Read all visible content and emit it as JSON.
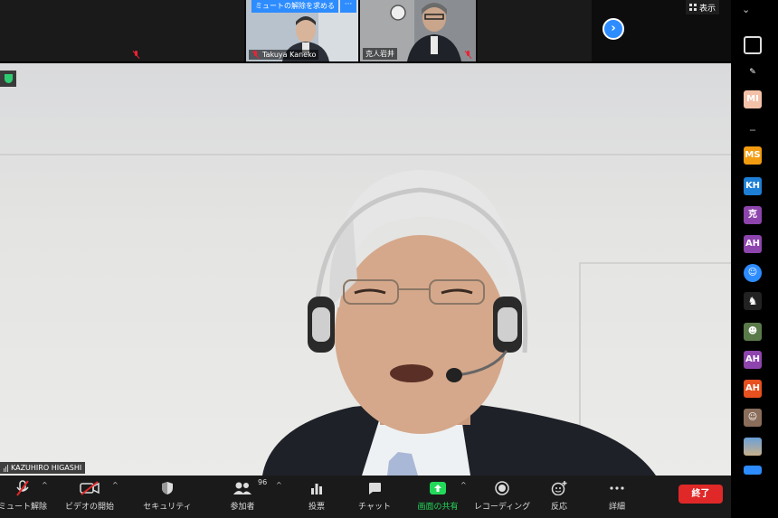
{
  "top_strip": {
    "unmute_request_label": "ミュートの解除を求める",
    "more_label": "···",
    "thumbnails": [
      {
        "name": "Takuya Kaneko"
      },
      {
        "name": "克人岩井"
      }
    ],
    "next_page_icon": "chevron-right-icon",
    "view_label": "表示"
  },
  "main_video": {
    "speaker_name": "KAZUHIRO HIGASHI"
  },
  "sidebar": {
    "collapse_icon": "chevron-down-icon",
    "tiles": [
      {
        "label": "",
        "bg": "#000000"
      },
      {
        "label": "",
        "bg": "#000000"
      },
      {
        "label": "MI",
        "bg": "#f3c1a8"
      },
      {
        "label": "",
        "bg": "#000000"
      },
      {
        "label": "MS",
        "bg": "#f39c12"
      },
      {
        "label": "KH",
        "bg": "#1e7fd6"
      },
      {
        "label": "克",
        "bg": "#8e44ad"
      },
      {
        "label": "AH",
        "bg": "#8e44ad"
      },
      {
        "label": "",
        "bg": "#2d8cff"
      },
      {
        "label": "",
        "bg": "#222222"
      },
      {
        "label": "",
        "bg": "#5a7a4a"
      },
      {
        "label": "AH",
        "bg": "#8e44ad"
      },
      {
        "label": "AH",
        "bg": "#e8501f"
      },
      {
        "label": "",
        "bg": "#8a6d5a"
      },
      {
        "label": "",
        "bg": "#4a7fb8"
      },
      {
        "label": "",
        "bg": "#2d8cff"
      }
    ]
  },
  "toolbar": {
    "items": [
      {
        "label": "ミュート解除",
        "icon": "mic-off-icon"
      },
      {
        "label": "ビデオの開始",
        "icon": "video-off-icon"
      },
      {
        "label": "セキュリティ",
        "icon": "shield-icon"
      },
      {
        "label": "参加者",
        "icon": "participants-icon"
      },
      {
        "label": "投票",
        "icon": "poll-icon"
      },
      {
        "label": "チャット",
        "icon": "chat-icon"
      },
      {
        "label": "画面の共有",
        "icon": "share-screen-icon"
      },
      {
        "label": "レコーディング",
        "icon": "record-icon"
      },
      {
        "label": "反応",
        "icon": "reaction-icon"
      },
      {
        "label": "詳細",
        "icon": "more-icon"
      }
    ],
    "participant_count": "96",
    "end_label": "終了",
    "share_color": "#23d959",
    "end_color": "#e02828"
  }
}
